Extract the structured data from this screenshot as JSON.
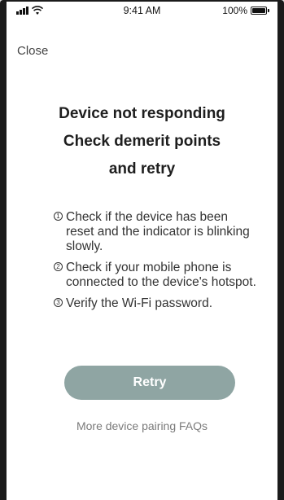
{
  "status_bar": {
    "time": "9:41 AM",
    "battery_text": "100%",
    "battery_level": 1.0
  },
  "header": {
    "close_label": "Close"
  },
  "message": {
    "lines": [
      "Device not responding",
      "Check demerit points",
      "and retry"
    ]
  },
  "steps": [
    {
      "number": "1",
      "text": "Check if the device has been reset and the indicator is blinking slowly."
    },
    {
      "number": "2",
      "text": "Check if your mobile phone is connected to the device's hotspot."
    },
    {
      "number": "3",
      "text": "Verify the Wi-Fi password."
    }
  ],
  "actions": {
    "retry_label": "Retry",
    "faq_label": "More device pairing FAQs"
  },
  "colors": {
    "button_bg": "#8fa5a3",
    "button_text": "#ffffff",
    "link_text": "#7a7a7a"
  },
  "icons": {
    "signal": "cellular-signal-icon",
    "wifi": "wifi-icon",
    "battery": "battery-icon"
  }
}
